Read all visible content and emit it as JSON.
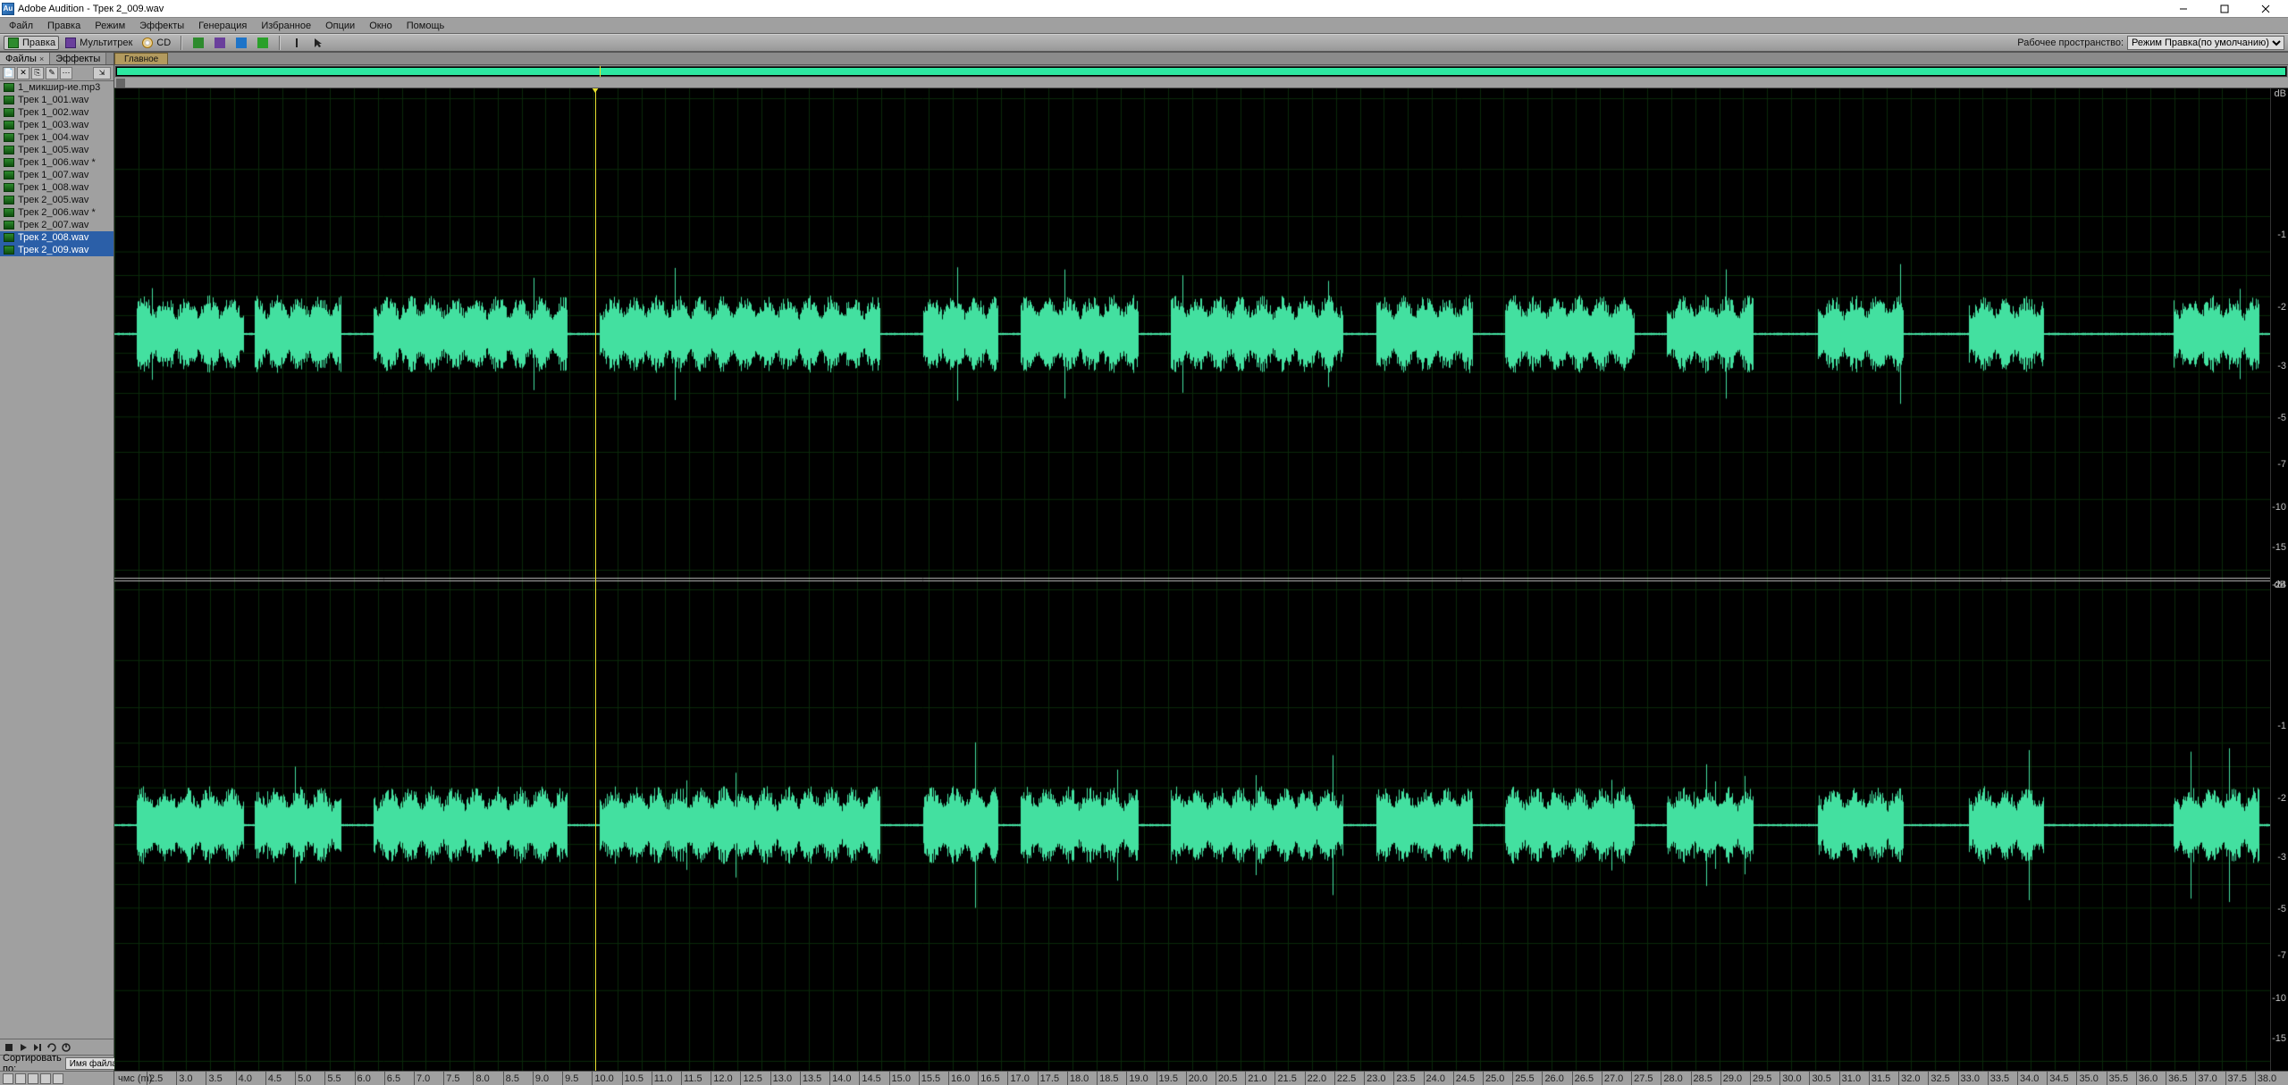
{
  "app": {
    "title": "Adobe Audition - Трек 2_009.wav",
    "logo_text": "Au"
  },
  "menu": [
    "Файл",
    "Правка",
    "Режим",
    "Эффекты",
    "Генерация",
    "Избранное",
    "Опции",
    "Окно",
    "Помощь"
  ],
  "toolbar": {
    "edit_label": "Правка",
    "multitrack_label": "Мультитрек",
    "cd_label": "CD",
    "workspace_label": "Рабочее пространство:",
    "workspace_value": "Режим Правка(по умолчанию)"
  },
  "left": {
    "tabs": [
      {
        "label": "Файлы",
        "closable": true,
        "active": true
      },
      {
        "label": "Эффекты",
        "closable": false,
        "active": false
      }
    ],
    "files": [
      {
        "name": "1_микшир-ие.mp3"
      },
      {
        "name": "Трек 1_001.wav"
      },
      {
        "name": "Трек 1_002.wav"
      },
      {
        "name": "Трек 1_003.wav"
      },
      {
        "name": "Трек 1_004.wav"
      },
      {
        "name": "Трек 1_005.wav"
      },
      {
        "name": "Трек 1_006.wav *"
      },
      {
        "name": "Трек 1_007.wav"
      },
      {
        "name": "Трек 1_008.wav"
      },
      {
        "name": "Трек 2_005.wav"
      },
      {
        "name": "Трек 2_006.wav *"
      },
      {
        "name": "Трек 2_007.wav"
      },
      {
        "name": "Трек 2_008.wav",
        "selected": true
      },
      {
        "name": "Трек 2_009.wav",
        "selected": true
      }
    ],
    "sort_label": "Сортировать по:",
    "sort_value": "Имя файла"
  },
  "main": {
    "tab_label": "Главное",
    "time_unit_label": "чмс (m)",
    "time_ticks": [
      "2.5",
      "3.0",
      "3.5",
      "4.0",
      "4.5",
      "5.0",
      "5.5",
      "6.0",
      "6.5",
      "7.0",
      "7.5",
      "8.0",
      "8.5",
      "9.0",
      "9.5",
      "10.0",
      "10.5",
      "11.0",
      "11.5",
      "12.0",
      "12.5",
      "13.0",
      "13.5",
      "14.0",
      "14.5",
      "15.0",
      "15.5",
      "16.0",
      "16.5",
      "17.0",
      "17.5",
      "18.0",
      "18.5",
      "19.0",
      "19.5",
      "20.0",
      "20.5",
      "21.0",
      "21.5",
      "22.0",
      "22.5",
      "23.0",
      "23.5",
      "24.0",
      "24.5",
      "25.0",
      "25.5",
      "26.0",
      "26.5",
      "27.0",
      "27.5",
      "28.0",
      "28.5",
      "29.0",
      "29.5",
      "30.0",
      "30.5",
      "31.0",
      "31.5",
      "32.0",
      "32.5",
      "33.0",
      "33.5",
      "34.0",
      "34.5",
      "35.0",
      "35.5",
      "36.0",
      "36.5",
      "37.0",
      "37.5",
      "38.0"
    ],
    "db_labels": [
      "dB",
      "-1",
      "-2",
      "-3",
      "-5",
      "-7",
      "-10",
      "-15",
      "-24",
      "-24",
      "-15",
      "-10",
      "-7",
      "-5",
      "-3",
      "-2",
      "-1",
      "-"
    ],
    "playhead_percent": 22.3
  }
}
